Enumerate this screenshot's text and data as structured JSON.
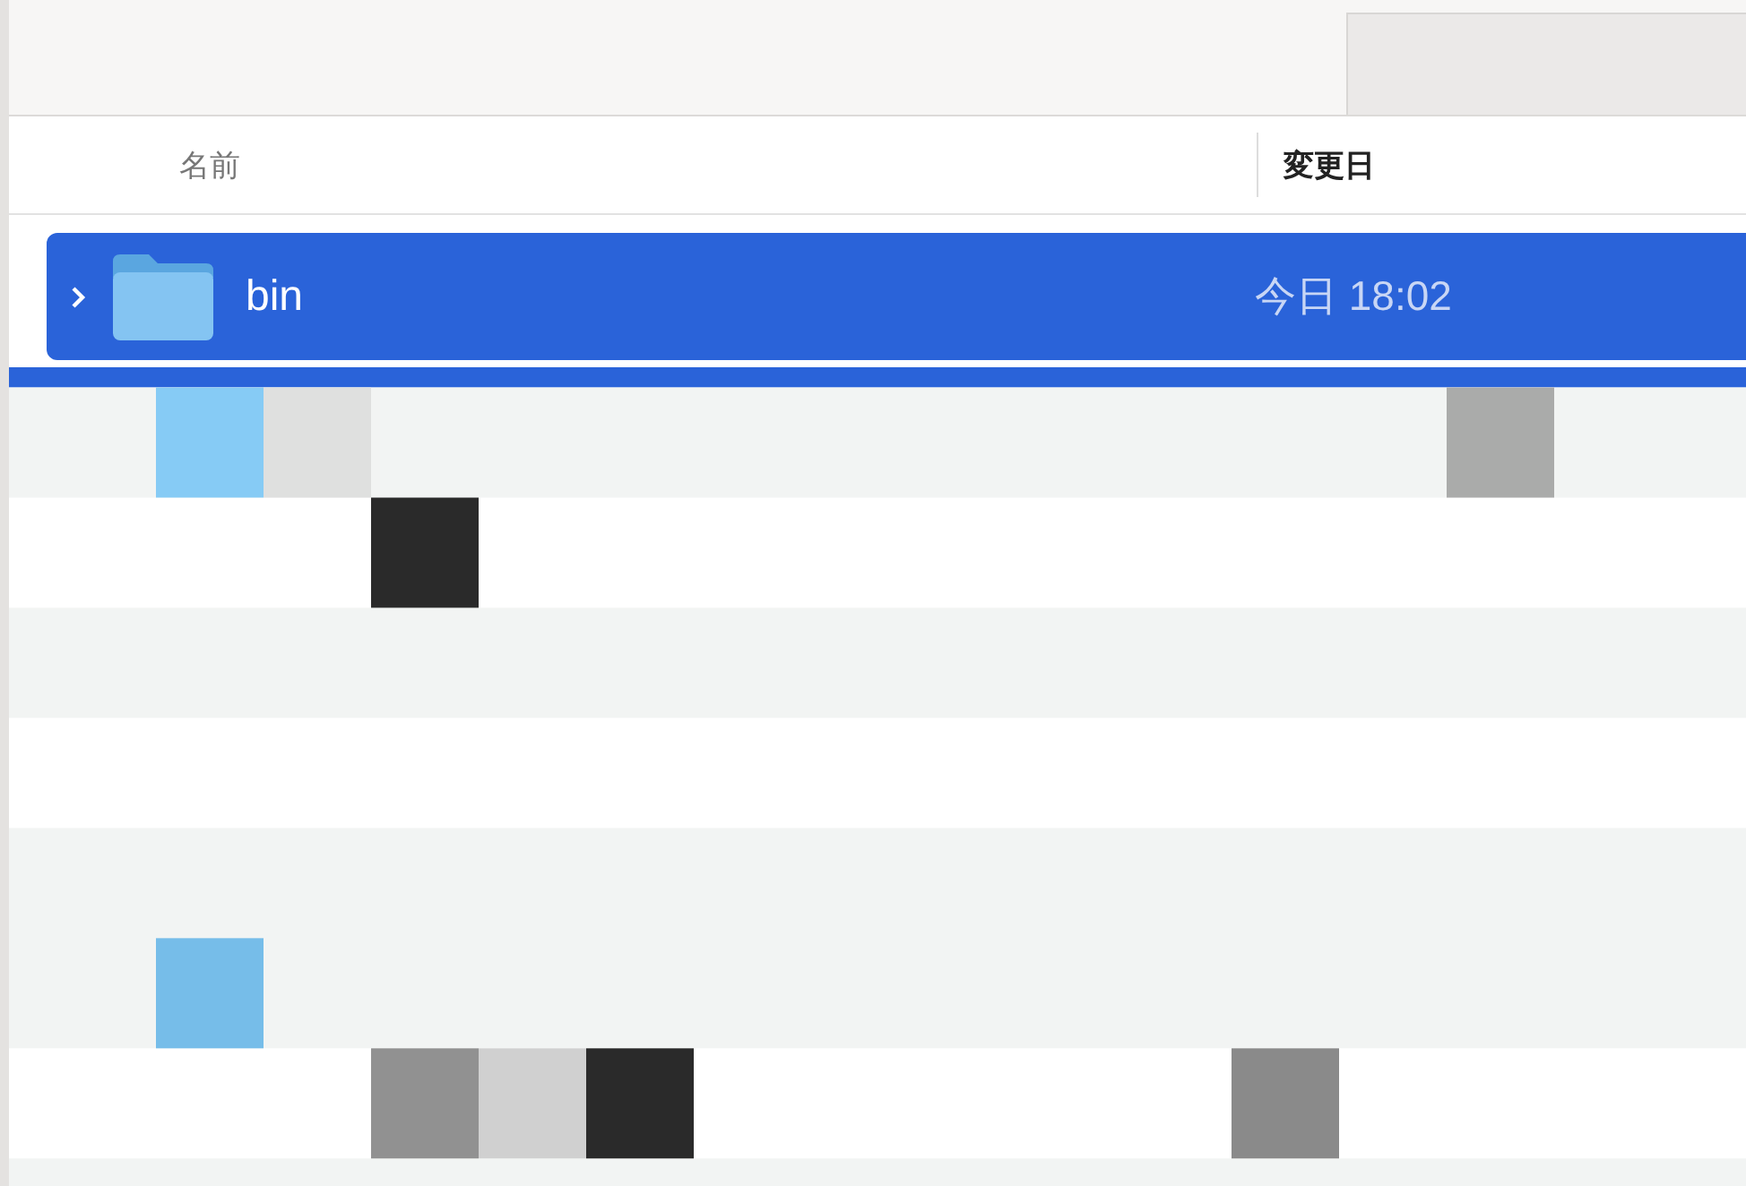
{
  "columns": [
    {
      "label": "名前",
      "sorted": false
    },
    {
      "label": "変更日",
      "sorted": true
    }
  ],
  "rows": [
    {
      "name": "bin",
      "modified": "今日 18:02",
      "expanded": false,
      "selected": true
    }
  ]
}
